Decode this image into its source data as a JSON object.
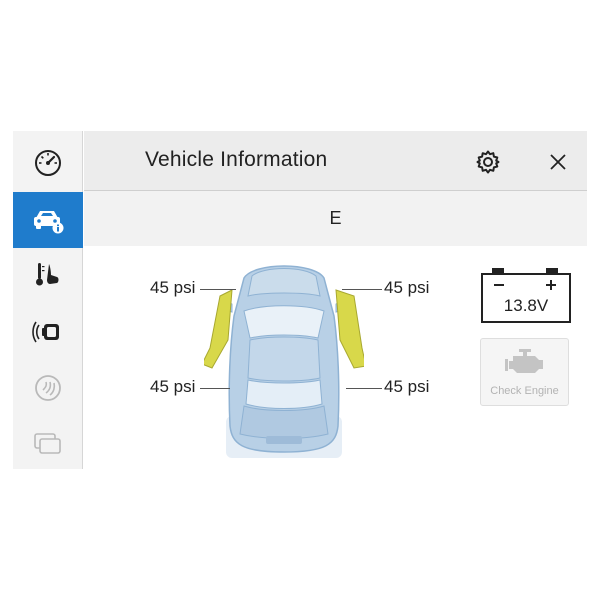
{
  "header": {
    "title": "Vehicle Information"
  },
  "subheader": {
    "label": "E"
  },
  "sidebar": {
    "items": [
      {
        "name": "dashboard",
        "icon": "speedometer-icon",
        "active": false,
        "enabled": true
      },
      {
        "name": "vehicle-info",
        "icon": "car-info-icon",
        "active": true,
        "enabled": true
      },
      {
        "name": "climate-seat",
        "icon": "seat-heat-icon",
        "active": false,
        "enabled": true
      },
      {
        "name": "parking-sensors",
        "icon": "parking-sensor-icon",
        "active": false,
        "enabled": true
      },
      {
        "name": "audio",
        "icon": "speaker-icon",
        "active": false,
        "enabled": false
      },
      {
        "name": "windows",
        "icon": "windows-icon",
        "active": false,
        "enabled": false
      }
    ]
  },
  "tires": {
    "front_left": "45 psi",
    "front_right": "45 psi",
    "rear_left": "45 psi",
    "rear_right": "45 psi"
  },
  "battery": {
    "voltage": "13.8V",
    "icon": "battery-icon"
  },
  "check_engine": {
    "label": "Check Engine",
    "icon": "engine-icon",
    "active": false
  },
  "doors": {
    "front_left_open": true,
    "front_right_open": true,
    "highlight_color": "#d8d84a"
  },
  "colors": {
    "accent": "#1f7ccc",
    "car_body": "#a9c6e0"
  }
}
